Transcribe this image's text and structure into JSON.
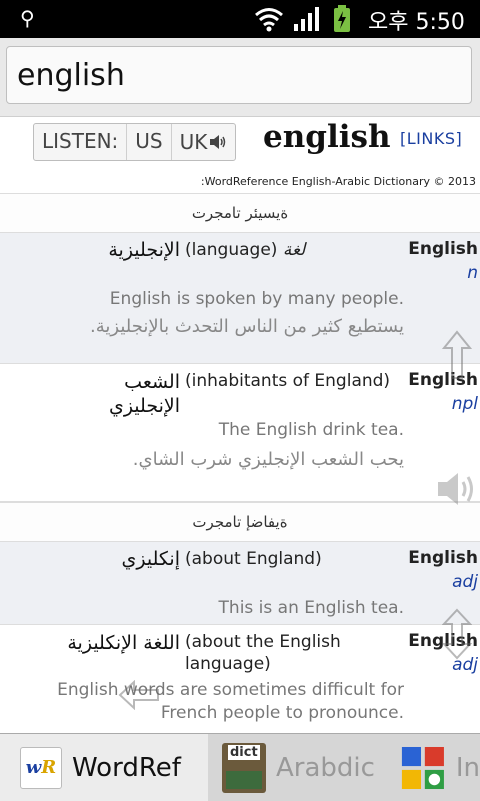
{
  "status_bar": {
    "time_label": "오후 5:50",
    "icons": [
      "usb-icon",
      "wifi-icon",
      "signal-icon",
      "battery-charging-icon"
    ]
  },
  "search": {
    "value": "english"
  },
  "header": {
    "listen_label": "LISTEN:",
    "us_label": "US",
    "uk_label": "UK",
    "headword": "english",
    "links_label": "[LINKS]",
    "copyright": ":WordReference English-Arabic Dictionary © 2013"
  },
  "sections": [
    {
      "title": "ةيسيئر تامجرت",
      "entries": [
        {
          "from_word": "English",
          "pos": "n",
          "translation": "الإنجليزية",
          "definition": "(language)",
          "definition_ar": "لغة",
          "example_en": "English is spoken by many people.",
          "example_tr": "يستطيع كثير من الناس التحدث بالإنجليزية."
        },
        {
          "from_word": "English",
          "pos": "npl",
          "translation": "الشعب الإنجليزي",
          "definition": "(inhabitants of England)",
          "definition_ar": "",
          "example_en": "The English drink tea.",
          "example_tr": "يحب الشعب الإنجليزي شرب الشاي."
        }
      ]
    },
    {
      "title": "ةيفاضإ تامجرت",
      "entries": [
        {
          "from_word": "English",
          "pos": "adj",
          "translation": "إنكليزي",
          "definition": "(about England)",
          "definition_ar": "",
          "example_en": "This is an English tea.",
          "example_tr": ""
        },
        {
          "from_word": "English",
          "pos": "adj",
          "translation": "اللغة الإنكليزية",
          "definition": "(about the English language)",
          "definition_ar": "",
          "example_en": "English words are sometimes difficult for French people to pronounce.",
          "example_tr": ""
        }
      ]
    }
  ],
  "tabs": [
    {
      "label": "WordRef",
      "icon": "wordreference-logo-icon"
    },
    {
      "label": "Arabdic",
      "icon": "arabic-dict-logo-icon"
    },
    {
      "label": "In",
      "icon": "colored-blocks-logo-icon"
    }
  ]
}
